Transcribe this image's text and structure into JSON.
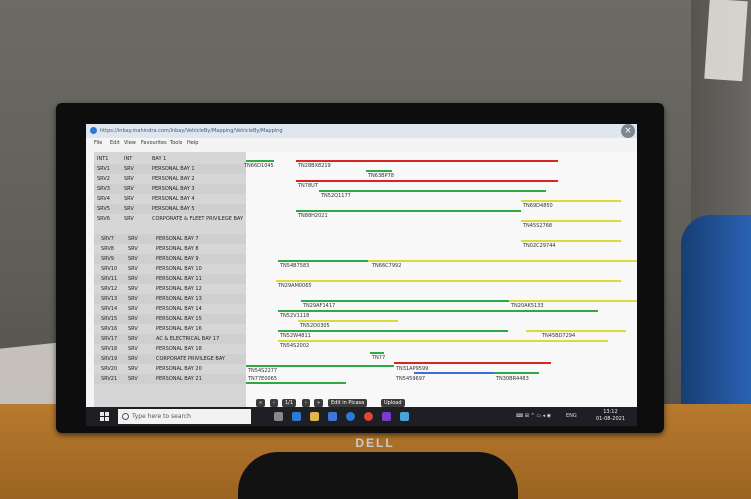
{
  "browser": {
    "url": "https://inbay.mahindra.com/Inbay/VehicleBy/Mapping/VehicleBy/Mapping",
    "menu": [
      "File",
      "Edit",
      "View",
      "Favourites",
      "Tools",
      "Help"
    ],
    "close_symbol": "×"
  },
  "bays": [
    {
      "id": "INT1",
      "type": "INT",
      "name": "BAY 1"
    },
    {
      "id": "SRV1",
      "type": "SRV",
      "name": "PERSONAL BAY 1"
    },
    {
      "id": "SRV2",
      "type": "SRV",
      "name": "PERSONAL BAY 2"
    },
    {
      "id": "SRV3",
      "type": "SRV",
      "name": "PERSONAL BAY 3"
    },
    {
      "id": "SRV4",
      "type": "SRV",
      "name": "PERSONAL BAY 4"
    },
    {
      "id": "SRV5",
      "type": "SRV",
      "name": "PERSONAL BAY 5"
    },
    {
      "id": "SRV6",
      "type": "SRV",
      "name": "CORPORATE & FLEET PRIVILEGE BAY"
    },
    {
      "id": "SRV7",
      "type": "SRV",
      "name": "PERSONAL BAY 7"
    },
    {
      "id": "SRV8",
      "type": "SRV",
      "name": "PERSONAL BAY 8"
    },
    {
      "id": "SRV9",
      "type": "SRV",
      "name": "PERSONAL BAY 9"
    },
    {
      "id": "SRV10",
      "type": "SRV",
      "name": "PERSONAL BAY 10"
    },
    {
      "id": "SRV11",
      "type": "SRV",
      "name": "PERSONAL BAY 11"
    },
    {
      "id": "SRV12",
      "type": "SRV",
      "name": "PERSONAL BAY 12"
    },
    {
      "id": "SRV13",
      "type": "SRV",
      "name": "PERSONAL BAY 13"
    },
    {
      "id": "SRV14",
      "type": "SRV",
      "name": "PERSONAL BAY 14"
    },
    {
      "id": "SRV15",
      "type": "SRV",
      "name": "PERSONAL BAY 15"
    },
    {
      "id": "SRV16",
      "type": "SRV",
      "name": "PERSONAL BAY 16"
    },
    {
      "id": "SRV17",
      "type": "SRV",
      "name": "AC & ELECTRICAL BAY 17"
    },
    {
      "id": "SRV18",
      "type": "SRV",
      "name": "PERSONAL BAY 18"
    },
    {
      "id": "SRV19",
      "type": "SRV",
      "name": "CORPORATE PRIVILEGE BAY"
    },
    {
      "id": "SRV20",
      "type": "SRV",
      "name": "PERSONAL BAY 20"
    },
    {
      "id": "SRV21",
      "type": "SRV",
      "name": "PERSONAL BAY 21"
    }
  ],
  "vehicles": [
    "TN66D1045",
    "TN28BX8219",
    "TN63BP78",
    "TN78UT",
    "TN52Q1177",
    "TN69D4850",
    "TN88H2021",
    "TN45S2768",
    "TN02C29744",
    "TN54B7583",
    "TN66C7992",
    "TN29AM0065",
    "TN29AF1417",
    "TN20AK5133",
    "TN52V1118",
    "TN52D0305",
    "TN52W4811",
    "TN45BD7294",
    "TN54S2002",
    "TN77",
    "TN54S2277",
    "TN31AP9599",
    "TN77E0065",
    "TN5459697",
    "TN30BR4483"
  ],
  "media_controls": {
    "first": "«",
    "prev": "‹",
    "counter": "1/1",
    "next": "›",
    "last": "»",
    "edit": "Edit in Picasa",
    "upload": "Upload"
  },
  "taskbar": {
    "search_placeholder": "Type here to search",
    "lang": "ENG",
    "time": "13:12",
    "date": "01-08-2021"
  },
  "brand": "DELL",
  "colors": {
    "bar_red": "#d7261e",
    "bar_green": "#2fa84a",
    "bar_yellow": "#dada3a",
    "bar_blue": "#3b6fd6"
  }
}
